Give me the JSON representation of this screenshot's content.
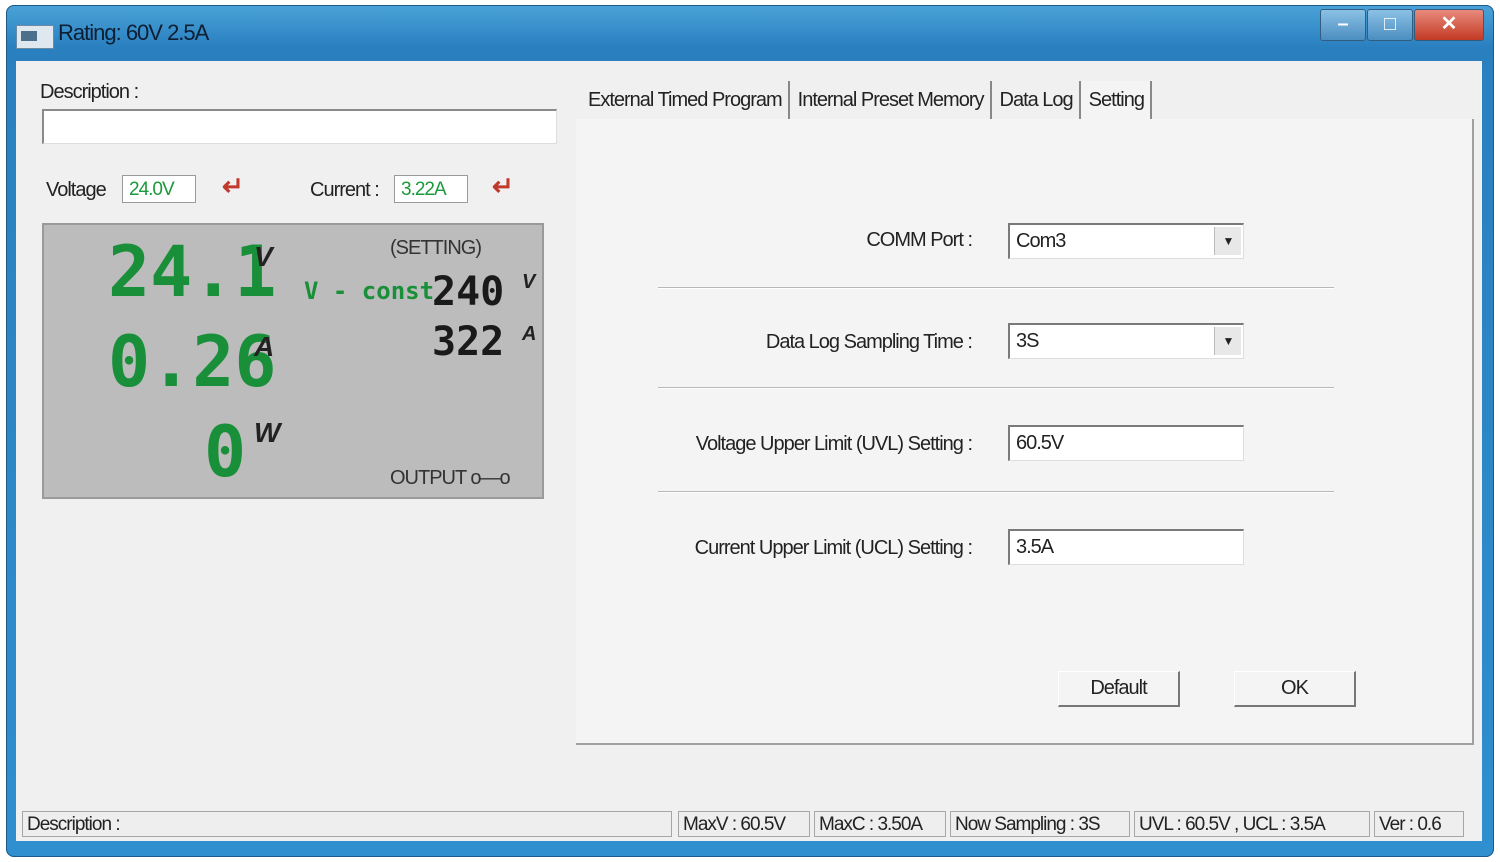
{
  "window": {
    "title": "Rating: 60V 2.5A",
    "buttons": [
      "–",
      "□",
      "✕"
    ]
  },
  "left": {
    "description_label": "Description :",
    "description_value": "",
    "voltage_label": "Voltage",
    "voltage_value": "24.0V",
    "current_label": "Current :",
    "current_value": "3.22A",
    "enter_glyph": "↵"
  },
  "display": {
    "voltage": "24.1",
    "voltage_unit": "V",
    "current": "0.26",
    "current_unit": "A",
    "power": "0",
    "power_unit": "W",
    "setting_label": "(SETTING)",
    "mode": "V - const",
    "set_voltage": "240",
    "set_voltage_unit": "V",
    "set_current": "322",
    "set_current_unit": "A",
    "output_label": "OUTPUT o—o"
  },
  "tabs": [
    {
      "label": "External Timed Program"
    },
    {
      "label": "Internal Preset Memory"
    },
    {
      "label": "Data Log"
    },
    {
      "label": "Setting"
    }
  ],
  "settings": {
    "comm_port_label": "COMM Port :",
    "comm_port_value": "Com3",
    "sampling_label": "Data Log Sampling Time :",
    "sampling_value": "3S",
    "uvl_label": "Voltage Upper Limit (UVL) Setting :",
    "uvl_value": "60.5V",
    "ucl_label": "Current Upper Limit (UCL) Setting :",
    "ucl_value": "3.5A",
    "dropdown_glyph": "▼",
    "default_button": "Default",
    "ok_button": "OK"
  },
  "status": {
    "description": "Description :",
    "maxv": "MaxV : 60.5V",
    "maxc": "MaxC : 3.50A",
    "sampling": "Now Sampling : 3S",
    "limits": "UVL : 60.5V , UCL : 3.5A",
    "version": "Ver : 0.6"
  }
}
